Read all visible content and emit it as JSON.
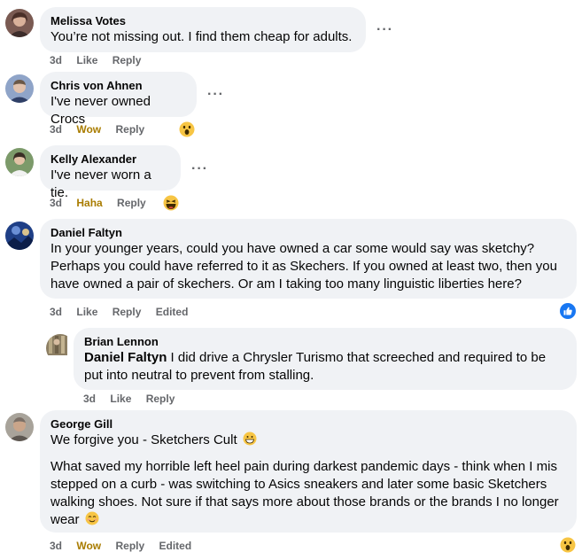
{
  "comments": [
    {
      "author": "Melissa Votes",
      "text": "You’re not missing out. I find them cheap for adults.",
      "actions": {
        "time": "3d",
        "like": "Like",
        "reply": "Reply"
      }
    },
    {
      "author": "Chris von Ahnen",
      "text": "I've never owned Crocs",
      "actions": {
        "time": "3d",
        "reaction": "Wow",
        "reply": "Reply"
      },
      "reaction_icon": "wow-emoji"
    },
    {
      "author": "Kelly Alexander",
      "text": "I've never worn a tie.",
      "actions": {
        "time": "3d",
        "reaction": "Haha",
        "reply": "Reply"
      },
      "reaction_icon": "haha-emoji"
    },
    {
      "author": "Daniel Faltyn",
      "text": "In your younger years, could you have owned a car some would say was sketchy? Perhaps you could have referred to it as Skechers. If you owned at least two, then you have owned a pair of skechers. Or am I taking too many linguistic liberties here?",
      "actions": {
        "time": "3d",
        "like": "Like",
        "reply": "Reply",
        "edited": "Edited"
      },
      "reaction_icon": "like-thumb"
    },
    {
      "author": "Brian Lennon",
      "mention": "Daniel Faltyn",
      "text": "I did drive a Chrysler Turismo that screeched and required to be put into neutral to prevent from stalling.",
      "actions": {
        "time": "3d",
        "like": "Like",
        "reply": "Reply"
      }
    },
    {
      "author": "George Gill",
      "text_line1": "We forgive you - Sketchers Cult",
      "text_para2": "What saved my horrible left heel pain during darkest pandemic days - think when I mis stepped on a curb - was switching to Asics sneakers and later some basic Sketchers walking shoes. Not sure if that says more about those brands or the brands I no longer wear",
      "actions": {
        "time": "3d",
        "reaction": "Wow",
        "reply": "Reply",
        "edited": "Edited"
      },
      "reaction_icon": "wow-emoji"
    }
  ],
  "more_options": "···",
  "colors": {
    "bubble": "#f0f2f5",
    "meta": "#65676b",
    "wow": "#a97c00",
    "like_blue": "#1877f2"
  }
}
